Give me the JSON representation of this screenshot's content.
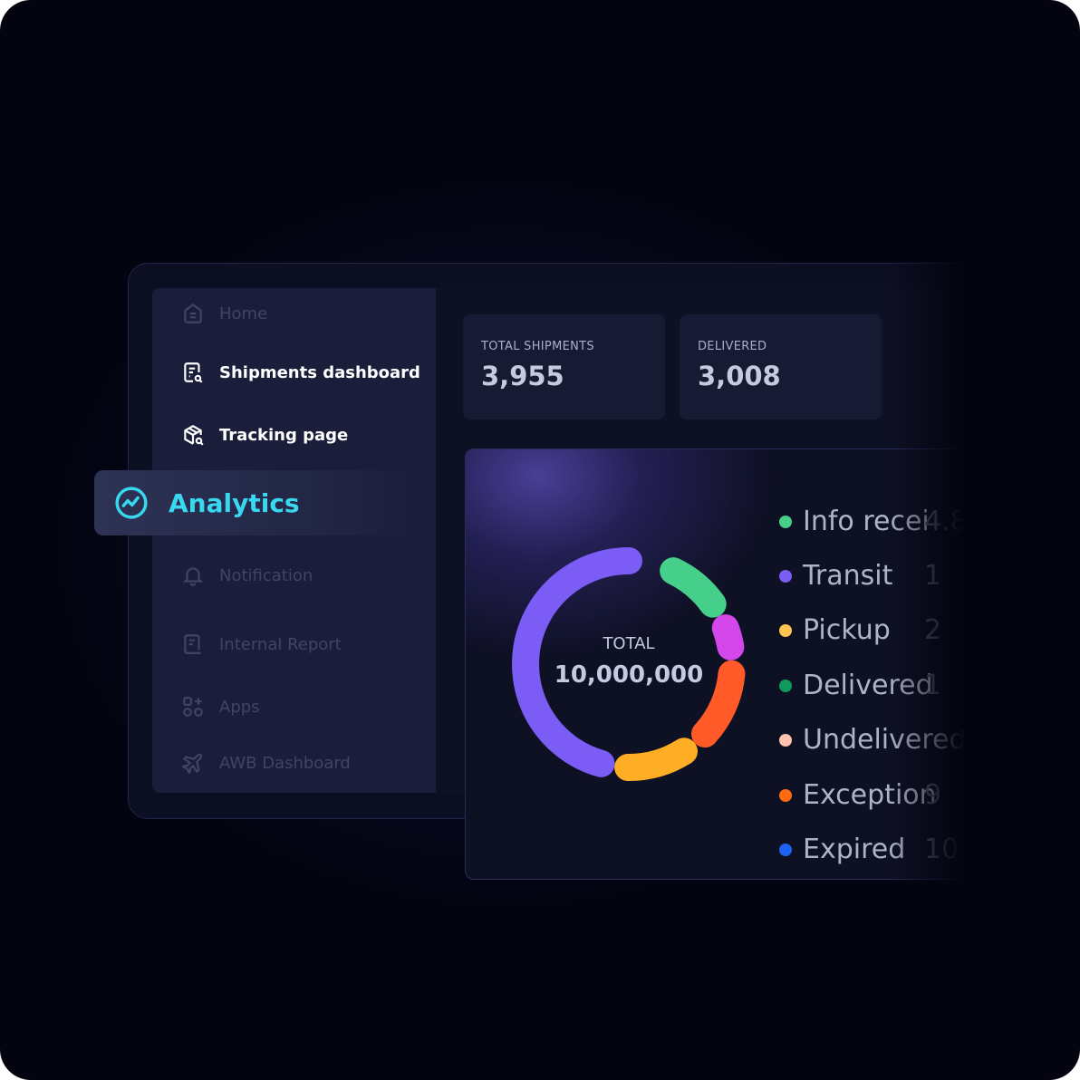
{
  "sidebar": {
    "items": [
      {
        "label": "Home",
        "icon": "home-icon",
        "state": "dim"
      },
      {
        "label": "Shipments dashboard",
        "icon": "document-search-icon",
        "state": "bright"
      },
      {
        "label": "Tracking page",
        "icon": "package-search-icon",
        "state": "bright"
      },
      {
        "label": "Analytics",
        "icon": "analytics-icon",
        "state": "active"
      },
      {
        "label": "Notification",
        "icon": "bell-icon",
        "state": "dim"
      },
      {
        "label": "Internal Report",
        "icon": "report-icon",
        "state": "dim"
      },
      {
        "label": "Apps",
        "icon": "apps-icon",
        "state": "dim"
      },
      {
        "label": "AWB Dashboard",
        "icon": "plane-icon",
        "state": "dim"
      }
    ],
    "accent": "#38d9f0"
  },
  "stats": [
    {
      "label": "TOTAL SHIPMENTS",
      "value": "3,955"
    },
    {
      "label": "DELIVERED",
      "value": "3,008"
    }
  ],
  "chart_data": {
    "type": "pie",
    "center_label": "TOTAL",
    "center_value": "10,000,000",
    "legend": [
      {
        "name": "Info received",
        "display": "Info recei",
        "value": "4.8",
        "color": "#45cf8a"
      },
      {
        "name": "Transit",
        "display": "Transit",
        "value": "1",
        "color": "#7b5cf5"
      },
      {
        "name": "Pickup",
        "display": "Pickup",
        "value": "2",
        "color": "#fdc54f"
      },
      {
        "name": "Delivered",
        "display": "Delivered",
        "value": "1",
        "color": "#0e9a5a"
      },
      {
        "name": "Undelivered",
        "display": "Undelivered",
        "value": "",
        "color": "#fdc2b0"
      },
      {
        "name": "Exception",
        "display": "Exception",
        "value": "9",
        "color": "#ff6a14"
      },
      {
        "name": "Expired",
        "display": "Expired",
        "value": "10",
        "color": "#1e63f0"
      }
    ],
    "arcs": [
      {
        "color": "#7b5cf5",
        "start": 0.522,
        "share": 0.528
      },
      {
        "color": "#45cf8a",
        "start": 0.05,
        "share": 0.122
      },
      {
        "color": "#d447ea",
        "start": 0.172,
        "share": 0.072
      },
      {
        "color": "#fdae24",
        "start": 0.389,
        "share": 0.133
      },
      {
        "color": "#ff5a28",
        "start": 0.244,
        "share": 0.145
      }
    ]
  }
}
